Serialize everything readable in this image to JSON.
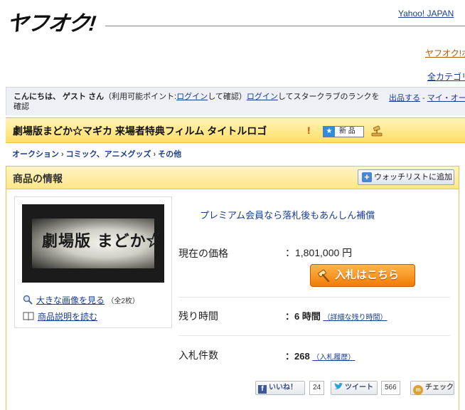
{
  "header": {
    "logo_text": "ヤフオク!",
    "yahoo_link": "Yahoo! JAPAN",
    "yahuoku_link": "ヤフオク!ホ",
    "all_categories_link": "全カテゴリ"
  },
  "greeting": {
    "hello": "こんにちは、 ゲスト さん",
    "points_prefix": "（利用可能ポイント:",
    "login1": "ログイン",
    "points_suffix": "して確認）",
    "login2": "ログイン",
    "starclub_text": "してスタークラブのランクを確認",
    "sell_link": "出品する",
    "sep": " - ",
    "my_auction_link": "マイ・オー"
  },
  "item": {
    "title": "劇場版まどか☆マギカ 来場者特典フィルム タイトルロゴ",
    "new_badge": "新 品"
  },
  "breadcrumb": [
    "オークション",
    "コミック、アニメグッズ",
    "その他"
  ],
  "info": {
    "section_title": "商品の情報",
    "watchlist_button": "ウォッチリストに追加",
    "enlarge_link": "大きな画像を見る",
    "image_count": "（全2枚）",
    "description_link": "商品説明を読む",
    "thumbnail_text": "劇場版 まどか☆マギカ",
    "premium_link": "プレミアム会員なら落札後もあんしん補償",
    "price_label": "現在の価格",
    "price_value": "：1,801,000 円",
    "bid_button": "入札はこちら",
    "remaining_label": "残り時間",
    "remaining_value": "：6 時間",
    "remaining_detail": "（詳細な残り時間）",
    "bids_label": "入札件数",
    "bids_value": "：268",
    "bids_history": "（入札履歴）"
  },
  "social": {
    "like_label": "いいね！",
    "like_count": "24",
    "tweet_label": "ツイート",
    "tweet_count": "566",
    "check_label": "チェック"
  }
}
